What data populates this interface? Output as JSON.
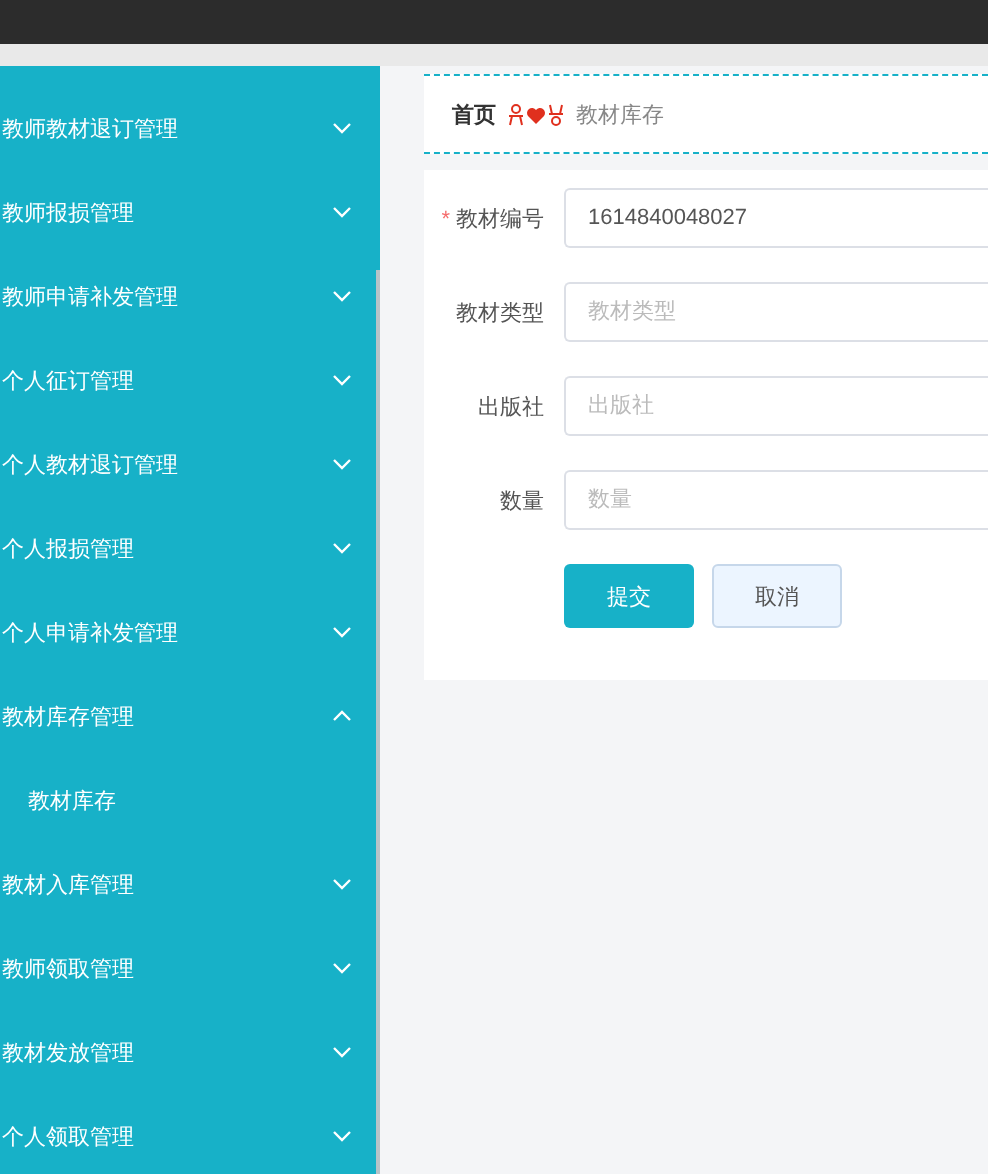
{
  "sidebar": {
    "items": [
      {
        "label": "教师教材退订管理",
        "expanded": false
      },
      {
        "label": "教师报损管理",
        "expanded": false
      },
      {
        "label": "教师申请补发管理",
        "expanded": false
      },
      {
        "label": "个人征订管理",
        "expanded": false
      },
      {
        "label": "个人教材退订管理",
        "expanded": false
      },
      {
        "label": "个人报损管理",
        "expanded": false
      },
      {
        "label": "个人申请补发管理",
        "expanded": false
      },
      {
        "label": "教材库存管理",
        "expanded": true,
        "children": [
          {
            "label": "教材库存"
          }
        ]
      },
      {
        "label": "教材入库管理",
        "expanded": false
      },
      {
        "label": "教师领取管理",
        "expanded": false
      },
      {
        "label": "教材发放管理",
        "expanded": false
      },
      {
        "label": "个人领取管理",
        "expanded": false
      }
    ]
  },
  "breadcrumb": {
    "home": "首页",
    "current": "教材库存"
  },
  "form": {
    "fields": [
      {
        "label": "教材编号",
        "required_mark": "*",
        "value": "1614840048027"
      },
      {
        "label": "教材类型",
        "placeholder": "教材类型"
      },
      {
        "label": "出版社",
        "placeholder": "出版社"
      },
      {
        "label": "数量",
        "placeholder": "数量"
      }
    ],
    "buttons": [
      {
        "label": "提交",
        "kind": "primary"
      },
      {
        "label": "取消",
        "kind": "secondary"
      }
    ]
  }
}
